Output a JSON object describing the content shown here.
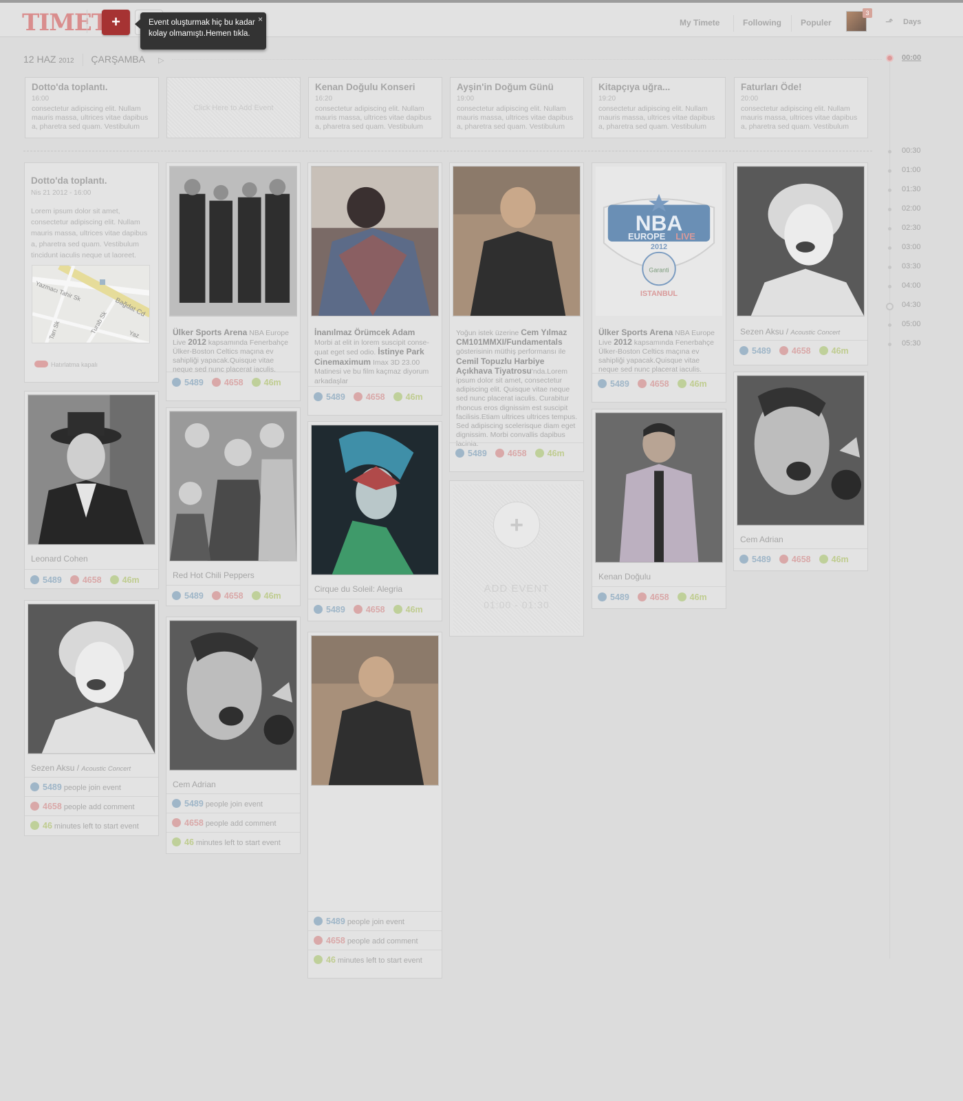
{
  "app": {
    "logo": "TIMETE",
    "add_button": "+",
    "tooltip": "Event oluşturmak hiç bu kadar kolay olmamıştı.Hemen tıkla.",
    "tooltip_close": "×",
    "nav": [
      "My Timete",
      "Following",
      "Populer"
    ],
    "notification_count": "3",
    "days_label": "Days"
  },
  "date": {
    "day_month": "12 HAZ",
    "year": "2012",
    "weekday": "ÇARŞAMBA",
    "next": "▷"
  },
  "top_events": [
    {
      "title": "Dotto'da toplantı.",
      "time": "16:00",
      "desc": "consectetur adipiscing elit. Nullam mauris massa, ultrices vitae dapibus a, pharetra sed quam. Vestibulum"
    },
    {
      "empty_label": "Click Here to Add Event"
    },
    {
      "title": "Kenan Doğulu Konseri",
      "time": "16:20",
      "desc": "consectetur adipiscing elit. Nullam mauris massa, ultrices vitae dapibus a, pharetra sed quam. Vestibulum"
    },
    {
      "title": "Ayşin'in Doğum Günü",
      "time": "19:00",
      "desc": "consectetur adipiscing elit. Nullam mauris massa, ultrices vitae dapibus a, pharetra sed quam. Vestibulum"
    },
    {
      "title": "Kitapçıya uğra...",
      "time": "19:20",
      "desc": "consectetur adipiscing elit. Nullam mauris massa, ultrices vitae dapibus a, pharetra sed quam. Vestibulum"
    },
    {
      "title": "Faturları Öde!",
      "time": "20:00",
      "desc": "consectetur adipiscing elit. Nullam mauris massa, ultrices vitae dapibus a, pharetra sed quam. Vestibulum"
    }
  ],
  "timeline": {
    "now": "00:00",
    "slots": [
      "00:30",
      "01:00",
      "01:30",
      "02:00",
      "02:30",
      "03:00",
      "03:30",
      "04:00",
      "04:30",
      "05:00",
      "05:30"
    ]
  },
  "stats": {
    "join": "5489",
    "comment": "4658",
    "minutes": "46m",
    "minutes_num": "46",
    "join_text": "people join event",
    "comment_text": "people add comment",
    "minutes_text": "minutes left to start event"
  },
  "cards": {
    "meeting": {
      "title": "Dotto'da toplantı.",
      "date": "Nis 21 2012  - 16:00",
      "desc": "Lorem ipsum dolor sit amet, consectetur adipiscing elit. Nullam mauris massa, ultrices vitae dapibus a, pharetra sed quam. Vestibulum tincidunt iaculis neque ut laoreet.",
      "map_streets": [
        "Yazmacı Tahir Sk",
        "Bağdat Cd",
        "Tarı Sk",
        "Turab Sk",
        "Yaz"
      ],
      "reminder": "Hatırlatma kapalı"
    },
    "leonard": {
      "name": "Leonard Cohen"
    },
    "sezen1": {
      "name": "Sezen Aksu / ",
      "sub": "Acoustic Concert"
    },
    "ulker1": {
      "title": "Ülker Sports Arena",
      "desc1": " NBA Europe Live ",
      "year": "2012",
      "desc2": " kapsamında Fenerbahçe Ülker-Boston Celtics maçına ev sahipliği yapacak.Quisque vitae neque sed nunc placerat iaculis."
    },
    "rhcp": {
      "name": "Red Hot Chili Peppers"
    },
    "cem_adrian1": {
      "name": "Cem Adrian"
    },
    "spiderman": {
      "title": "İnanılmaz Örümcek Adam",
      "desc1": "Morbi at elit in lorem suscipit conse-quat eget sed odio. ",
      "place": "İstinye Park Cinemaximum",
      "desc2": " Imax 3D 23.00 Matinesi ve bu film kaçmaz diyorum arkadaşlar"
    },
    "cirque": {
      "name": "Cirque du Soleil: Alegria"
    },
    "cem_yilmaz": {
      "pre": "Yoğun istek üzerine ",
      "name": "Cem Yılmaz",
      "show": "CM101MMXI/Fundamentals",
      "mid": " gösterisinin müthiş performansı ile ",
      "venue": "Cemil Topuzlu Harbiye Açıkhava Tiyatrosu",
      "post": "'nda.Lorem ipsum dolor sit amet, consectetur adipiscing elit. Quisque vitae neque sed nunc placerat iaculis. Curabitur rhoncus eros dignissim est suscipit facilisis.Etiam ultrices ultrices tempus. Sed adipiscing scelerisque diam eget dignissim. Morbi convallis dapibus lacinia."
    },
    "add_event": {
      "label": "ADD EVENT",
      "range": "01:00 - 01:30"
    },
    "ulker2": {
      "title": "Ülker Sports Arena",
      "desc1": " NBA Europe Live ",
      "year": "2012",
      "desc2": " kapsamında Fenerbahçe Ülker-Boston Celtics maçına ev sahipliği yapacak.Quisque vitae neque sed nunc placerat iaculis."
    },
    "nba_logo": {
      "line1": "NBA",
      "line2": "EUROPE",
      "line3": "LIVE",
      "year": "2012",
      "sponsor": "Garanti",
      "city": "ISTANBUL"
    },
    "kenan": {
      "name": "Kenan Doğulu"
    },
    "sezen2": {
      "name": "Sezen Aksu / ",
      "sub": "Acoustic Concert"
    },
    "cem_adrian2": {
      "name": "Cem Adrian"
    }
  }
}
